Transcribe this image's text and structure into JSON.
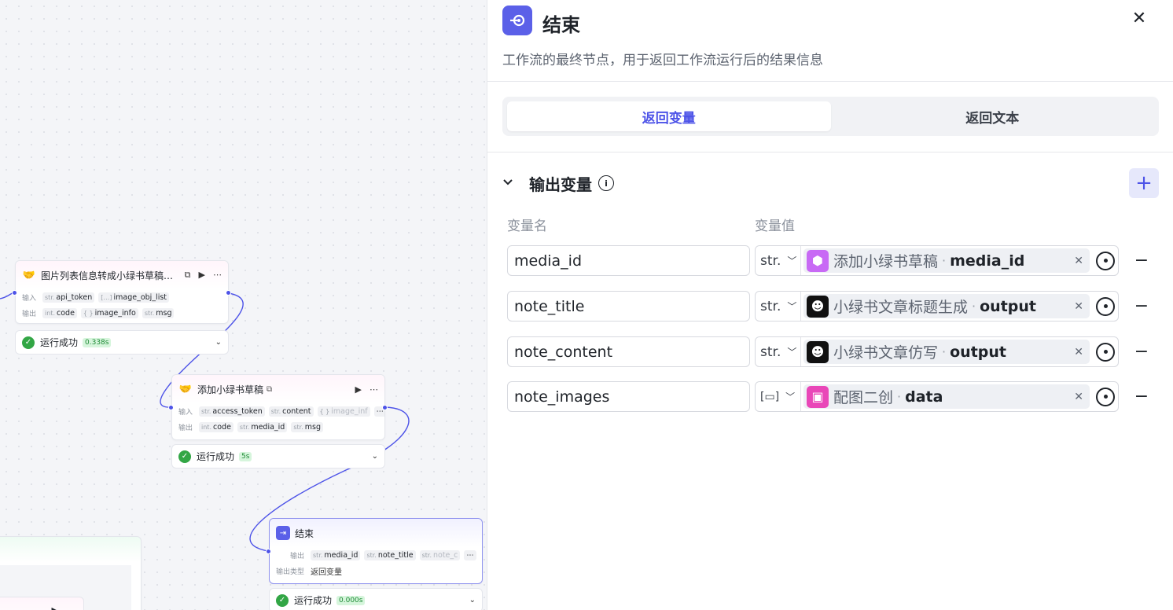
{
  "canvas": {
    "node1": {
      "title": "图片列表信息转成小绿书草稿…",
      "input_label": "输入",
      "output_label": "输出",
      "inputs": [
        {
          "type": "str.",
          "name": "api_token"
        },
        {
          "type": "[…]",
          "name": "image_obj_list"
        }
      ],
      "outputs": [
        {
          "type": "int.",
          "name": "code"
        },
        {
          "type": "{ }",
          "name": "image_info"
        },
        {
          "type": "str.",
          "name": "msg"
        }
      ],
      "status": "运行成功",
      "duration": "0.338s"
    },
    "node2": {
      "title": "添加小绿书草稿",
      "input_label": "输入",
      "output_label": "输出",
      "inputs": [
        {
          "type": "str.",
          "name": "access_token"
        },
        {
          "type": "str.",
          "name": "content"
        },
        {
          "type": "{ }",
          "name": "image_inf"
        }
      ],
      "outputs": [
        {
          "type": "int.",
          "name": "code"
        },
        {
          "type": "str.",
          "name": "media_id"
        },
        {
          "type": "str.",
          "name": "msg"
        }
      ],
      "status": "运行成功",
      "duration": "5s"
    },
    "node3": {
      "title": "结束",
      "output_label": "输出",
      "output_type_label": "输出类型",
      "output_type_value": "返回变量",
      "outputs": [
        {
          "type": "str.",
          "name": "media_id"
        },
        {
          "type": "str.",
          "name": "note_title"
        },
        {
          "type": "str.",
          "name": "note_c"
        }
      ],
      "status": "运行成功",
      "duration": "0.000s"
    }
  },
  "panel": {
    "title": "结束",
    "description": "工作流的最终节点，用于返回工作流运行后的结果信息",
    "tabs": [
      {
        "label": "返回变量",
        "active": true
      },
      {
        "label": "返回文本",
        "active": false
      }
    ],
    "section_title": "输出变量",
    "col_name": "变量名",
    "col_value": "变量值",
    "rows": [
      {
        "name": "media_id",
        "type": "str.",
        "ref_node": "添加小绿书草稿",
        "ref_field": "media_id",
        "icon_color": "#c86af5"
      },
      {
        "name": "note_title",
        "type": "str.",
        "ref_node": "小绿书文章标题生成",
        "ref_field": "output",
        "icon_color": "#111111"
      },
      {
        "name": "note_content",
        "type": "str.",
        "ref_node": "小绿书文章仿写",
        "ref_field": "output",
        "icon_color": "#111111"
      },
      {
        "name": "note_images",
        "type": "[▭]",
        "ref_node": "配图二创",
        "ref_field": "data",
        "icon_color": "#e947b8"
      }
    ],
    "separator": "·",
    "colors": {
      "accent": "#4d53e8",
      "success": "#32a645"
    }
  }
}
